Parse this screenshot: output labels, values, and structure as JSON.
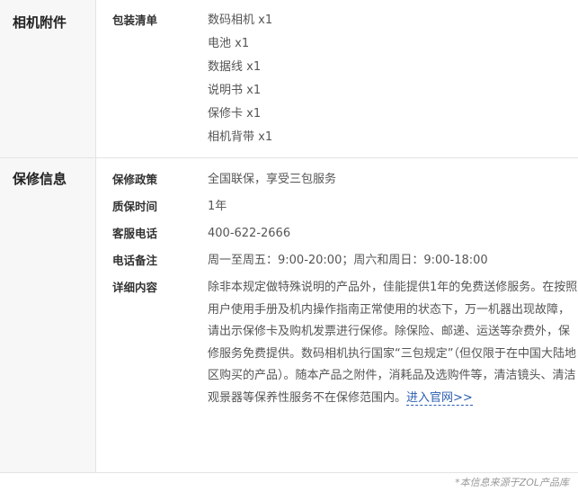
{
  "accessories": {
    "title": "相机附件",
    "package_label": "包装清单",
    "items": [
      "数码相机 x1",
      "电池 x1",
      "数据线 x1",
      "说明书 x1",
      "保修卡 x1",
      "相机背带 x1"
    ]
  },
  "warranty": {
    "title": "保修信息",
    "rows": [
      {
        "label": "保修政策",
        "value": "全国联保，享受三包服务"
      },
      {
        "label": "质保时间",
        "value": "1年"
      },
      {
        "label": "客服电话",
        "value": "400-622-2666"
      },
      {
        "label": "电话备注",
        "value": "周一至周五：9:00-20:00；周六和周日：9:00-18:00"
      }
    ],
    "detail_label": "详细内容",
    "detail_text": "除非本规定做特殊说明的产品外，佳能提供1年的免费送修服务。在按照用户使用手册及机内操作指南正常使用的状态下，万一机器出现故障，请出示保修卡及购机发票进行保修。除保险、邮递、运送等杂费外，保修服务免费提供。数码相机执行国家“三包规定”（但仅限于在中国大陆地区购买的产品）。随本产品之附件，消耗品及选购件等，清洁镜头、清洁观景器等保养性服务不在保修范围内。",
    "link_text": "进入官网>>"
  },
  "footer": "*本信息来源于ZOL产品库"
}
